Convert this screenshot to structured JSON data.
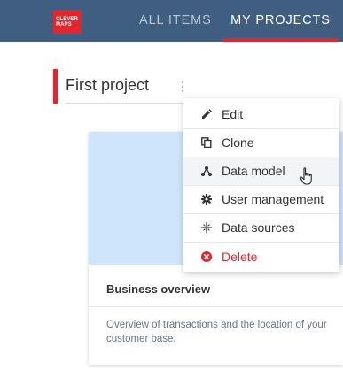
{
  "topbar": {
    "logo_line1": "CLEVER",
    "logo_line2": "MAPS",
    "tabs": [
      {
        "label": "ALL ITEMS",
        "active": false
      },
      {
        "label": "MY PROJECTS",
        "active": true
      }
    ]
  },
  "section": {
    "title": "First project",
    "more_icon": "kebab-vertical-icon"
  },
  "context_menu": {
    "items": [
      {
        "label": "Edit",
        "icon": "pencil-icon"
      },
      {
        "label": "Clone",
        "icon": "copy-icon"
      },
      {
        "label": "Data model",
        "icon": "hierarchy-icon"
      },
      {
        "label": "User management",
        "icon": "gear-icon"
      },
      {
        "label": "Data sources",
        "icon": "sparkle-icon"
      },
      {
        "label": "Delete",
        "icon": "delete-circle-icon"
      }
    ],
    "hovered_item": "Data model"
  },
  "card": {
    "title": "Business overview",
    "description": "Overview of transactions and the location of your customer base."
  },
  "colors": {
    "topbar": "#405f80",
    "accent": "#e1262d",
    "card_image": "#cfe5fb",
    "danger": "#e1262d"
  }
}
